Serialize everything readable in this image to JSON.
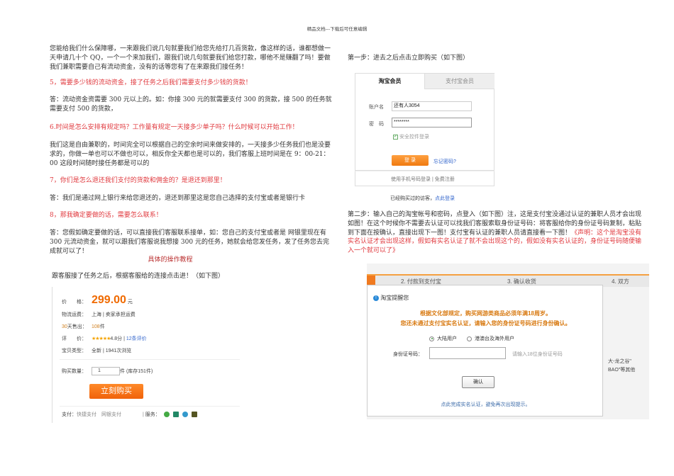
{
  "header": "精品文档---下载后可任意编辑",
  "left": {
    "p1": "您能给我们什么保障哪，一来跟我们说几句就要我们给您先给打几百货款，像这样的话，谁都想做一天申请几十个 QQ，一个一个来加我们，跟我们说几句就要我们给您打款，哪他不是赚翻了吗！要做我们兼职需要自己有流动资金，没有的话等您有了在来跟我们接任务！",
    "q5": "5，需要多少钱的流动资金，接了任务之后我们需要支付多少钱的货款！",
    "a5": "答：流动资金资需要 300 元以上的。如：你接 300 元的就需要支付 300 的货款，接 500 的任务就需要支付 500 的货款，",
    "q6": "6.时间是怎么安排有规定吗？工作量有规定一天接多少单子吗？什么时候可以开始工作！",
    "a6": "我们这是自由兼职的，时间完全可以根据自己的空余时间来做安排的，一天接多少任务我们也是没要求的，你做一单也可以不做也可以，相反你全天都也是可以的，我们客服上班时间是在 9：00-21：00 这段时间随时接任务都是可以的",
    "q7": "7，你们是怎么退还我们支付的货款和佣金的？是退还到那里！",
    "a7": "答：我们是通过网上银行来给您退还的，退还到那里这是您自己选择的支付宝或者是银行卡",
    "q8": "8，那我确定要做的话，需要怎么联系！",
    "a8": "答：您假如确定要做的话，可以直接我们客服联系接单，如：您自己的支付宝或者是 网银里现在有 300 元流动资金，就可以跟我们客服说我想接 300 元的任务，她就会给您发任务，发了任务您去完成就可以了！",
    "tutorial_title": "具体的操作教程",
    "intro": "跟客服接了任务之后，根据客服给的连接点击进！（如下图）"
  },
  "product": {
    "price_label": "价　　格：",
    "price": "299.00",
    "price_unit": "元",
    "shipping_label": "物流运费：",
    "shipping": "上海 | 卖家承担运费",
    "sold_label_num": "30",
    "sold_label": "天售出：",
    "sold_num": "108",
    "sold_unit": "件",
    "rating_label": "评　　价：",
    "stars": "★★★★★",
    "score": "4.8分",
    "reviews": "12条评价",
    "type_label": "宝贝类型：",
    "type": "全新 | 1941次浏览",
    "qty_label": "购买数量：",
    "qty": "1",
    "stock": "件 (库存151件)",
    "buy": "立刻购买",
    "pay_label": "支付：",
    "pay1": "快捷支付",
    "pay2": "网银支付",
    "service_label": "服务："
  },
  "right": {
    "step1": "第一步：进去之后点击立即购买（如下图）",
    "step2": "第二步：输入自己的淘宝帐号和密码，点登入（如下图）注，这是支付宝没通过认证的兼职人员才会出现如图！在这个时候你不需要去认证可以找我们客服索取身份证号码：将客服给你的身份证号码复制，粘贴到下面在按确认，直接出现下一图！支付宝有认证的兼职人员请直接看一下图！",
    "statement": "《声明：这个是淘宝没有实名认证才会出现这样，假如有实名认证了就不会出现这个的，假如没有实名认证的，身份证号码随便输入一个就可以了》"
  },
  "login": {
    "tab1": "淘宝会员",
    "tab2": "支付宝会员",
    "user_label": "账户名",
    "user": "还有人3054",
    "pwd_label": "密　码",
    "pwd": "********",
    "secure": "安全控件登录",
    "login": "登 录",
    "forgot": "忘记密码?",
    "phone": "使用手机号码登录",
    "register": "免费注册",
    "guest": "已经购买过的访客，",
    "guest_link": "点此登录"
  },
  "dialog": {
    "step2": "2. 付款到支付宝",
    "step3": "3. 确认收货",
    "step4": "4. 双方",
    "title": "淘宝提醒您",
    "msg1": "根据文化部规定，购买网游类商品必须年满18周岁。",
    "msg2": "您还未通过支付宝实名认证，请输入您的身份证号码进行身份确认。",
    "radio1": "大陆用户",
    "radio2": "港澳台及海外用户",
    "id_label": "身份证号码：",
    "id_hint": "请输入18位身份证号码",
    "confirm": "确认",
    "link": "点此完成实名认证，避免再次出现提示。",
    "bg1": "大-龙之谷\"",
    "bg2": "BAO\"等其他"
  }
}
